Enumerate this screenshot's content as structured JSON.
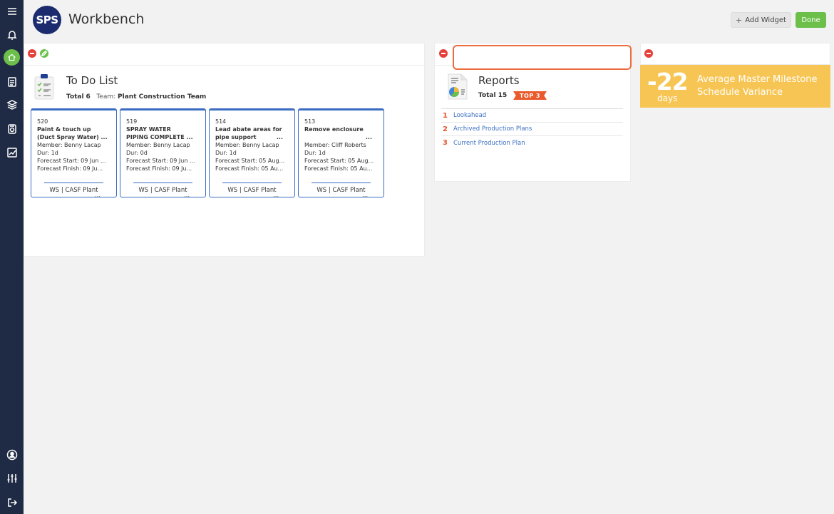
{
  "header": {
    "logo_text": "SPS",
    "title": "Workbench",
    "add_widget_label": "Add Widget",
    "add_widget_icon": "plus-icon",
    "done_label": "Done"
  },
  "rail": {
    "top_icons": [
      "hamburger-menu-icon",
      "bell-icon",
      "home-icon",
      "checklist-icon",
      "layers-icon",
      "document-icon",
      "chart-icon"
    ],
    "bottom_icons": [
      "user-icon",
      "sliders-icon",
      "logout-icon"
    ],
    "accent": "#6cbf4b",
    "background": "#1f2a44"
  },
  "todo": {
    "title": "To Do List",
    "total_label": "Total",
    "total": "6",
    "team_label": "Team:",
    "team": "Plant Construction Team",
    "cards": [
      {
        "id": "520",
        "title_1": "Paint & touch up",
        "title_2": "(Duct Spray Water) ...",
        "member": "Member: Benny Lacap",
        "dur": "Dur: 1d",
        "start": "Forecast Start: 09 Jun ...",
        "finish": "Forecast Finish: 09 Ju...",
        "footer": "WS | CASF Plant",
        "title_more": ""
      },
      {
        "id": "519",
        "title_1": "SPRAY WATER",
        "title_2": "PIPING COMPLETE ...",
        "member": "Member: Benny Lacap",
        "dur": "Dur: 0d",
        "start": "Forecast Start: 09 Jun ...",
        "finish": "Forecast Finish: 09 Ju...",
        "footer": "WS | CASF Plant",
        "title_more": ""
      },
      {
        "id": "514",
        "title_1": "Lead abate areas for",
        "title_2": "pipe support",
        "member": "Member: Benny Lacap",
        "dur": "Dur: 1d",
        "start": "Forecast Start: 05 Aug...",
        "finish": "Forecast Finish: 05 Au...",
        "footer": "WS | CASF Plant",
        "title_more": "..."
      },
      {
        "id": "513",
        "title_1": "Remove enclosure",
        "title_2": "",
        "member": "Member: Cliff Roberts",
        "dur": "Dur: 1d",
        "start": "Forecast Start: 05 Aug...",
        "finish": "Forecast Finish: 05 Au...",
        "footer": "WS | CASF Plant",
        "title_more": "..."
      }
    ],
    "card_more": "..."
  },
  "reports": {
    "search_value": "",
    "title": "Reports",
    "total": "Total 15",
    "badge": "TOP 3",
    "items": [
      {
        "n": "1",
        "label": "Lookahead"
      },
      {
        "n": "2",
        "label": "Archived Production Plans"
      },
      {
        "n": "3",
        "label": "Current Production Plan"
      }
    ]
  },
  "variance": {
    "value": "-22",
    "unit": "days",
    "label_1": "Average Master Milestone",
    "label_2": "Schedule Variance",
    "color": "#f7c553"
  }
}
